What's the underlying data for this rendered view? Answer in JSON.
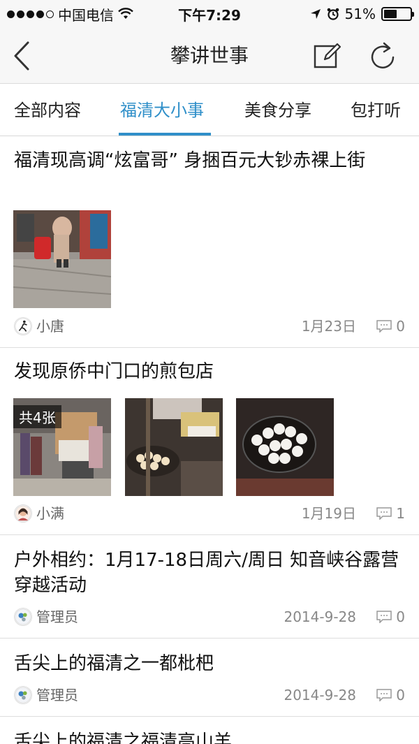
{
  "status_bar": {
    "carrier": "中国电信",
    "time": "下午7:29",
    "battery": "51%",
    "battery_level": 0.51
  },
  "nav": {
    "title": "攀讲世事",
    "back_icon": "chevron-left-icon",
    "edit_icon": "compose-icon",
    "refresh_icon": "refresh-icon"
  },
  "tabs": [
    {
      "label": "全部内容",
      "active": false
    },
    {
      "label": "福清大小事",
      "active": true
    },
    {
      "label": "美食分享",
      "active": false
    },
    {
      "label": "包打听",
      "active": false
    }
  ],
  "accent_color": "#2f8fc9",
  "posts": [
    {
      "title": "福清现高调“炫富哥” 身捆百元大钞赤裸上街",
      "author": "小唐",
      "date": "1月23日",
      "comments": "0"
    },
    {
      "title": "发现原侨中门口的煎包店",
      "photo_badge": "共4张",
      "author": "小满",
      "date": "1月19日",
      "comments": "1"
    },
    {
      "title": "户外相约：1月17-18日周六/周日 知音峡谷露营穿越活动",
      "author": "管理员",
      "date": "2014-9-28",
      "comments": "0"
    },
    {
      "title": "舌尖上的福清之一都枇杷",
      "author": "管理员",
      "date": "2014-9-28",
      "comments": "0"
    },
    {
      "title": "舌尖上的福清之福清高山羊"
    }
  ]
}
